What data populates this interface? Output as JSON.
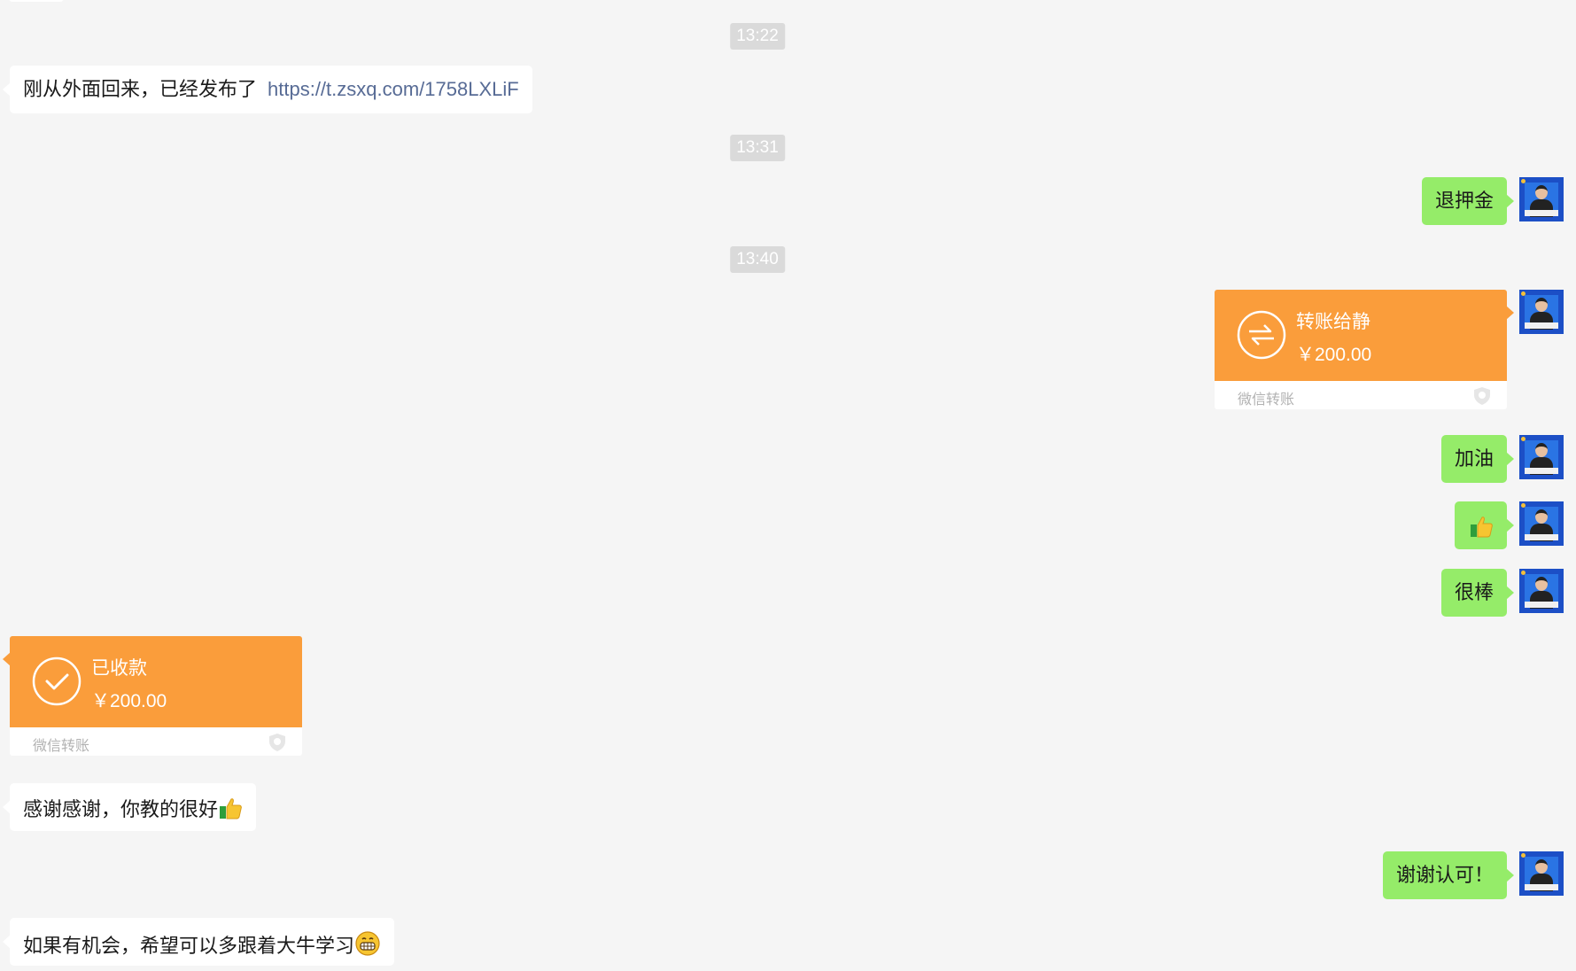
{
  "messages": {
    "t1322": "13:22",
    "m1": {
      "text": "刚从外面回来，已经发布了",
      "link": "https://t.zsxq.com/1758LXLiF"
    },
    "t1331": "13:31",
    "m2": "退押金",
    "t1340": "13:40",
    "transfer_sent": {
      "title": "转账给静",
      "amount": "￥200.00",
      "footer": "微信转账"
    },
    "m3": "加油",
    "m4_emoji": "thumbs-up-emoji",
    "m5": "很棒",
    "transfer_received": {
      "title": "已收款",
      "amount": "￥200.00",
      "footer": "微信转账"
    },
    "m6": {
      "text": "感谢感谢，你教的很好",
      "emoji": "thumbs-up-emoji"
    },
    "m7": "谢谢认可！",
    "m8": {
      "text": "如果有机会，希望可以多跟着大牛学习",
      "emoji": "grinning-face-emoji"
    }
  },
  "colors": {
    "background": "#f5f5f5",
    "bubble_self": "#95ec69",
    "bubble_other": "#ffffff",
    "transfer": "#fa9d3b",
    "link": "#576b95",
    "time_badge": "#dadada"
  }
}
